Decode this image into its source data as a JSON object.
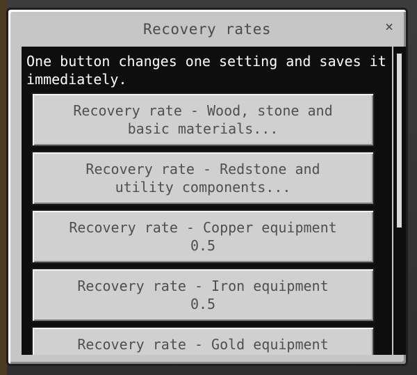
{
  "dialog": {
    "title": "Recovery rates",
    "close_icon": "×",
    "intro": "One button changes one setting and saves it immediately."
  },
  "buttons": [
    {
      "line1": "Recovery rate - Wood, stone and",
      "line2": "basic materials..."
    },
    {
      "line1": "Recovery rate - Redstone and",
      "line2": "utility components..."
    },
    {
      "line1": "Recovery rate - Copper equipment",
      "line2": "0.5"
    },
    {
      "line1": "Recovery rate - Iron equipment",
      "line2": "0.5"
    },
    {
      "line1": "Recovery rate - Gold equipment",
      "line2": ""
    }
  ]
}
